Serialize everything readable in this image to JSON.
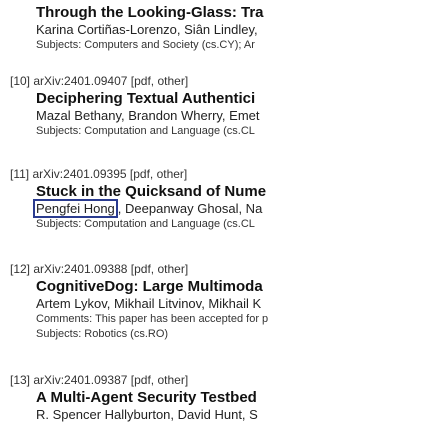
{
  "entries": [
    {
      "title": "Through the Looking-Glass: Tra",
      "authors": "Karina Cortiñas-Lorenzo, Siân Lindley,",
      "subjects": "Subjects: Computers and Society (cs.CY); Ar"
    },
    {
      "index": "[10]",
      "arxiv_id": "arXiv:2401.09407",
      "links": "[pdf, other]",
      "title": "Deciphering Textual Authentici",
      "authors": "Mazal Bethany, Brandon Wherry, Emet",
      "subjects": "Subjects: Computation and Language (cs.CL"
    },
    {
      "index": "[11]",
      "arxiv_id": "arXiv:2401.09395",
      "links": "[pdf, other]",
      "title": "Stuck in the Quicksand of Nume",
      "author_highlight": "Pengfei Hong",
      "authors_rest": ", Deepanway Ghosal, Na",
      "subjects": "Subjects: Computation and Language (cs.CL"
    },
    {
      "index": "[12]",
      "arxiv_id": "arXiv:2401.09388",
      "links": "[pdf, other]",
      "title": "CognitiveDog: Large Multimoda",
      "authors": "Artem Lykov, Mikhail Litvinov, Mikhail K",
      "comments": "Comments: This paper has been accepted for p",
      "subjects": "Subjects: Robotics (cs.RO)"
    },
    {
      "index": "[13]",
      "arxiv_id": "arXiv:2401.09387",
      "links": "[pdf, other]",
      "title": "A Multi-Agent Security Testbed",
      "authors": "R. Spencer Hallyburton, David Hunt, S"
    }
  ]
}
